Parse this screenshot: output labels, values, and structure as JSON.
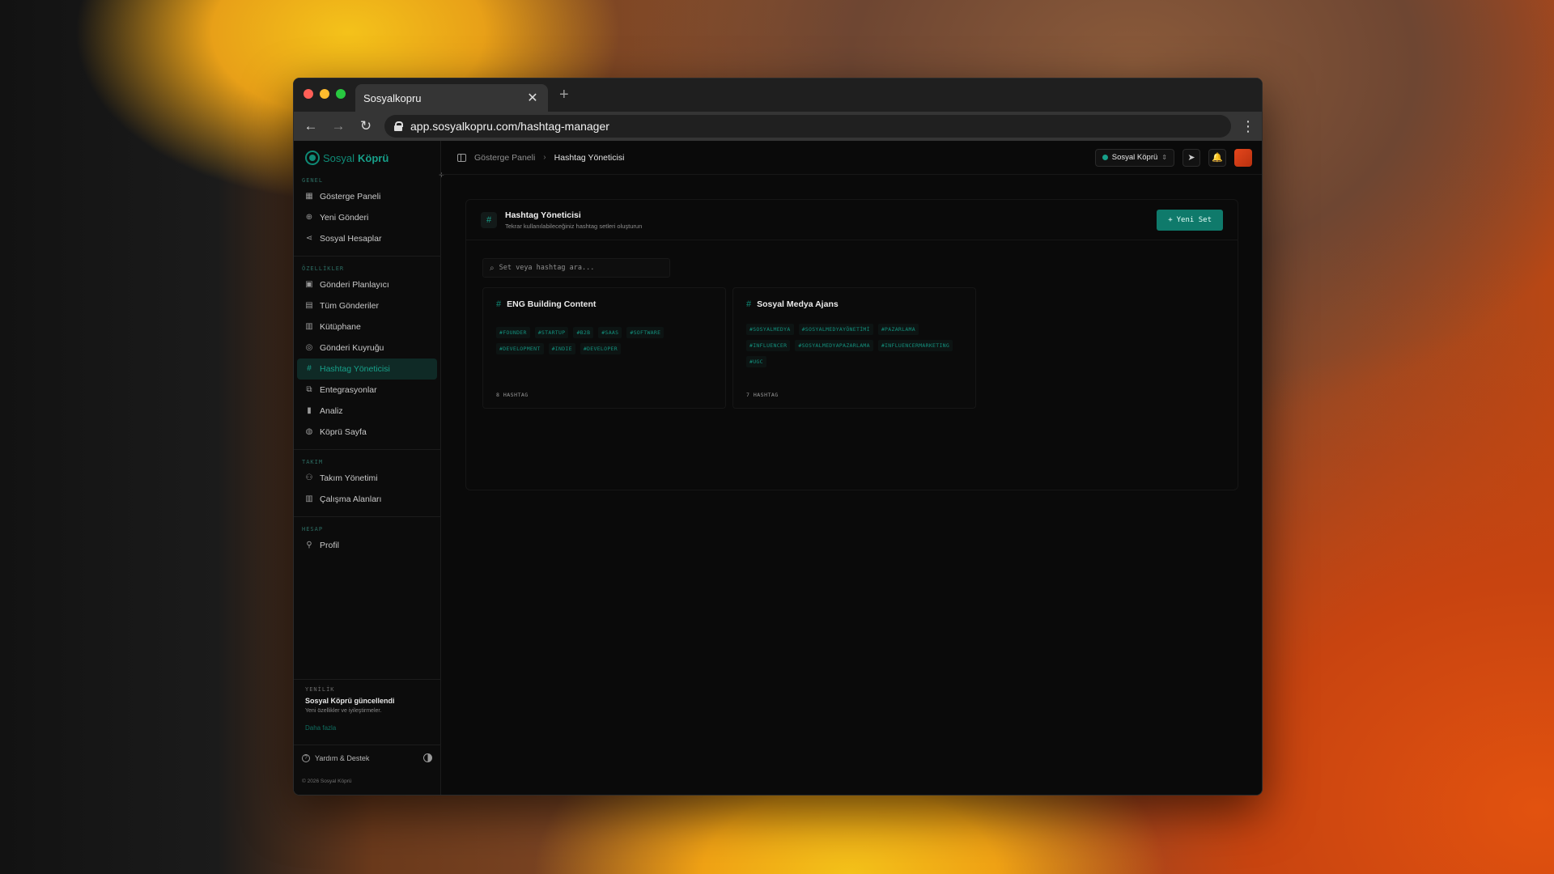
{
  "browser": {
    "tab_title": "Sosyalkopru",
    "url": "app.sosyalkopru.com/hashtag-manager"
  },
  "brand": {
    "logo_part1": "Sosyal",
    "logo_part2": "Köprü",
    "accent_color": "#0f8a76"
  },
  "sidebar": {
    "sections": [
      {
        "label": "GENEL",
        "items": [
          {
            "label": "Gösterge Paneli",
            "icon": "grid-icon"
          },
          {
            "label": "Yeni Gönderi",
            "icon": "plus-circle-icon"
          },
          {
            "label": "Sosyal Hesaplar",
            "icon": "share-icon"
          }
        ]
      },
      {
        "label": "ÖZELLİKLER",
        "items": [
          {
            "label": "Gönderi Planlayıcı",
            "icon": "calendar-icon"
          },
          {
            "label": "Tüm Gönderiler",
            "icon": "document-icon"
          },
          {
            "label": "Kütüphane",
            "icon": "library-icon"
          },
          {
            "label": "Gönderi Kuyruğu",
            "icon": "queue-icon"
          },
          {
            "label": "Hashtag Yöneticisi",
            "icon": "hash-icon",
            "active": true
          },
          {
            "label": "Entegrasyonlar",
            "icon": "integration-icon"
          },
          {
            "label": "Analiz",
            "icon": "bar-chart-icon"
          },
          {
            "label": "Köprü Sayfa",
            "icon": "globe-icon"
          }
        ]
      },
      {
        "label": "TAKIM",
        "items": [
          {
            "label": "Takım Yönetimi",
            "icon": "users-icon"
          },
          {
            "label": "Çalışma Alanları",
            "icon": "building-icon"
          }
        ]
      },
      {
        "label": "HESAP",
        "items": [
          {
            "label": "Profil",
            "icon": "user-icon"
          }
        ]
      }
    ],
    "update": {
      "label": "YENİLİK",
      "title": "Sosyal Köprü güncellendi",
      "subtitle": "Yeni özellikler ve iyileştirmeler.",
      "link": "Daha fazla"
    },
    "help_label": "Yardım & Destek",
    "copyright": "© 2026 Sosyal Köprü"
  },
  "topbar": {
    "breadcrumb_root": "Gösterge Paneli",
    "breadcrumb_current": "Hashtag Yöneticisi",
    "workspace": "Sosyal Köprü"
  },
  "page": {
    "title": "Hashtag Yöneticisi",
    "subtitle": "Tekrar kullanılabileceğiniz hashtag setleri oluşturun",
    "new_set_label": "Yeni Set",
    "search_placeholder": "Set veya hashtag ara..."
  },
  "sets": [
    {
      "name": "ENG Building Content",
      "tags": [
        "#FOUNDER",
        "#STARTUP",
        "#B2B",
        "#SAAS",
        "#SOFTWARE",
        "#DEVELOPMENT",
        "#INDIE",
        "#DEVELOPER"
      ],
      "count_label": "8 HASHTAG"
    },
    {
      "name": "Sosyal Medya Ajans",
      "tags": [
        "#SOSYALMEDYA",
        "#SOSYALMEDYAYÖNETİMİ",
        "#PAZARLAMA",
        "#INFLUENCER",
        "#SOSYALMEDYAPAZARLAMA",
        "#INFLUENCERMARKETING",
        "#UGC"
      ],
      "count_label": "7 HASHTAG"
    }
  ]
}
